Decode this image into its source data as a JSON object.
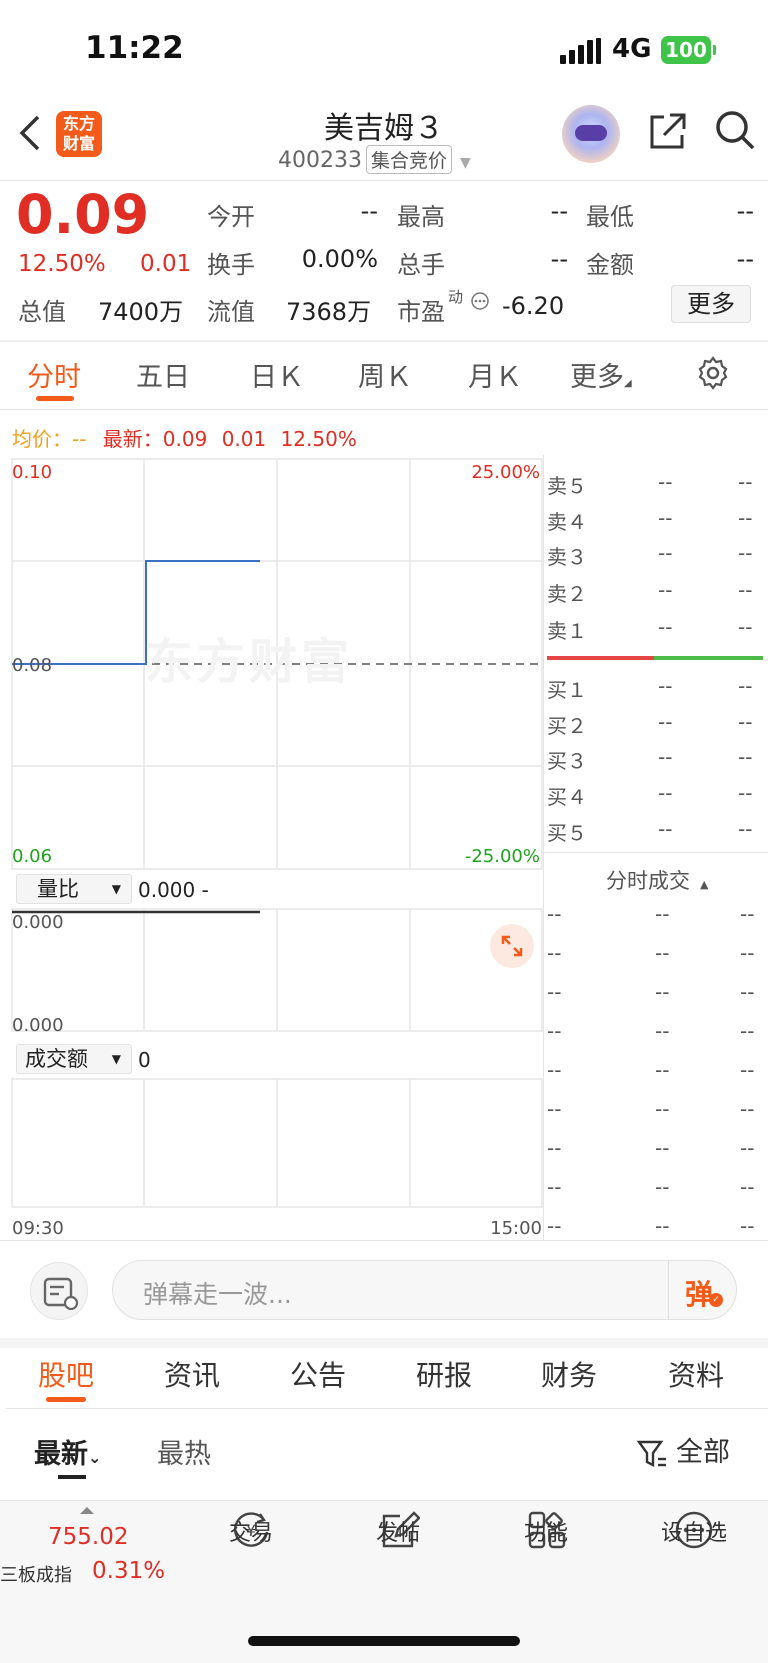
{
  "status": {
    "time": "11:22",
    "network": "4G",
    "battery": "100"
  },
  "nav": {
    "logo": "东方财富",
    "title": "美吉姆３",
    "code": "400233",
    "tag": "集合竞价"
  },
  "quote": {
    "price": "0.09",
    "pct": "12.50%",
    "chg": "0.01",
    "open_label": "今开",
    "open": "--",
    "high_label": "最高",
    "high": "--",
    "low_label": "最低",
    "low": "--",
    "turnover_label": "换手",
    "turnover": "0.00%",
    "vol_label": "总手",
    "vol": "--",
    "amount_label": "金额",
    "amount": "--",
    "mcap_label": "总值",
    "mcap": "7400万",
    "float_label": "流值",
    "float": "7368万",
    "pe_label": "市盈",
    "pe_sup": "动",
    "pe": "-6.20",
    "more": "更多"
  },
  "tabs": [
    "分时",
    "五日",
    "日Ｋ",
    "周Ｋ",
    "月Ｋ",
    "更多"
  ],
  "info": {
    "avg_label": "均价：",
    "avg": "--",
    "latest_label": "最新：",
    "latest": "0.09",
    "chg": "0.01",
    "pct": "12.50%"
  },
  "axis": {
    "top": "0.10",
    "mid": "0.08",
    "bot": "0.06",
    "top_pct": "25.00%",
    "bot_pct": "-25.00%",
    "t_start": "09:30",
    "t_end": "15:00"
  },
  "vol": {
    "label": "量比",
    "value": "0.000 -",
    "top": "0.000",
    "bot": "0.000"
  },
  "amt": {
    "label": "成交额",
    "value": "0"
  },
  "watermark": "东方财富",
  "orderbook": {
    "sell": [
      {
        "l": "卖５",
        "p": "--",
        "v": "--"
      },
      {
        "l": "卖４",
        "p": "--",
        "v": "--"
      },
      {
        "l": "卖３",
        "p": "--",
        "v": "--"
      },
      {
        "l": "卖２",
        "p": "--",
        "v": "--"
      },
      {
        "l": "卖１",
        "p": "--",
        "v": "--"
      }
    ],
    "buy": [
      {
        "l": "买１",
        "p": "--",
        "v": "--"
      },
      {
        "l": "买２",
        "p": "--",
        "v": "--"
      },
      {
        "l": "买３",
        "p": "--",
        "v": "--"
      },
      {
        "l": "买４",
        "p": "--",
        "v": "--"
      },
      {
        "l": "买５",
        "p": "--",
        "v": "--"
      }
    ],
    "trades_title": "分时成交"
  },
  "trades": [
    [
      "--",
      "--",
      "--"
    ],
    [
      "--",
      "--",
      "--"
    ],
    [
      "--",
      "--",
      "--"
    ],
    [
      "--",
      "--",
      "--"
    ],
    [
      "--",
      "--",
      "--"
    ],
    [
      "--",
      "--",
      "--"
    ],
    [
      "--",
      "--",
      "--"
    ],
    [
      "--",
      "--",
      "--"
    ],
    [
      "--",
      "--",
      "--"
    ]
  ],
  "comment": {
    "placeholder": "弹幕走一波...",
    "btn": "弹"
  },
  "bottom_tabs": [
    "股吧",
    "资讯",
    "公告",
    "研报",
    "财务",
    "资料"
  ],
  "sort": {
    "latest": "最新",
    "hot": "最热",
    "filter": "全部"
  },
  "footer": {
    "index_value": "755.02",
    "index_name": "三板成指",
    "index_pct": "0.31%",
    "items": [
      "交易",
      "发帖",
      "功能",
      "设自选"
    ]
  },
  "colors": {
    "accent": "#f25b1a",
    "up": "#e02e24",
    "down": "#1fa31f",
    "line": "#3d6fc4"
  }
}
